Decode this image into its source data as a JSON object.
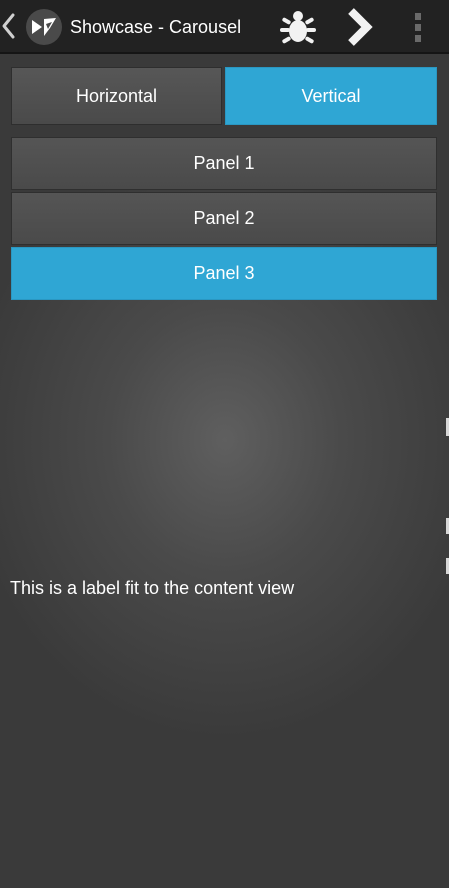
{
  "action_bar": {
    "title": "Showcase - Carousel",
    "icons": [
      "back-chevron-icon",
      "kivy-logo-icon",
      "bug-icon",
      "next-chevron-icon",
      "overflow-menu-icon"
    ]
  },
  "orientation": {
    "horizontal_label": "Horizontal",
    "vertical_label": "Vertical",
    "selected": "Vertical"
  },
  "panels": [
    {
      "label": "Panel 1",
      "selected": false
    },
    {
      "label": "Panel 2",
      "selected": false
    },
    {
      "label": "Panel 3",
      "selected": true
    }
  ],
  "content": {
    "label": "This is a label fit to the content view"
  },
  "colors": {
    "accent": "#2fa6d4",
    "action_bar": "#222222",
    "button": "#505050",
    "text": "#ffffff"
  }
}
